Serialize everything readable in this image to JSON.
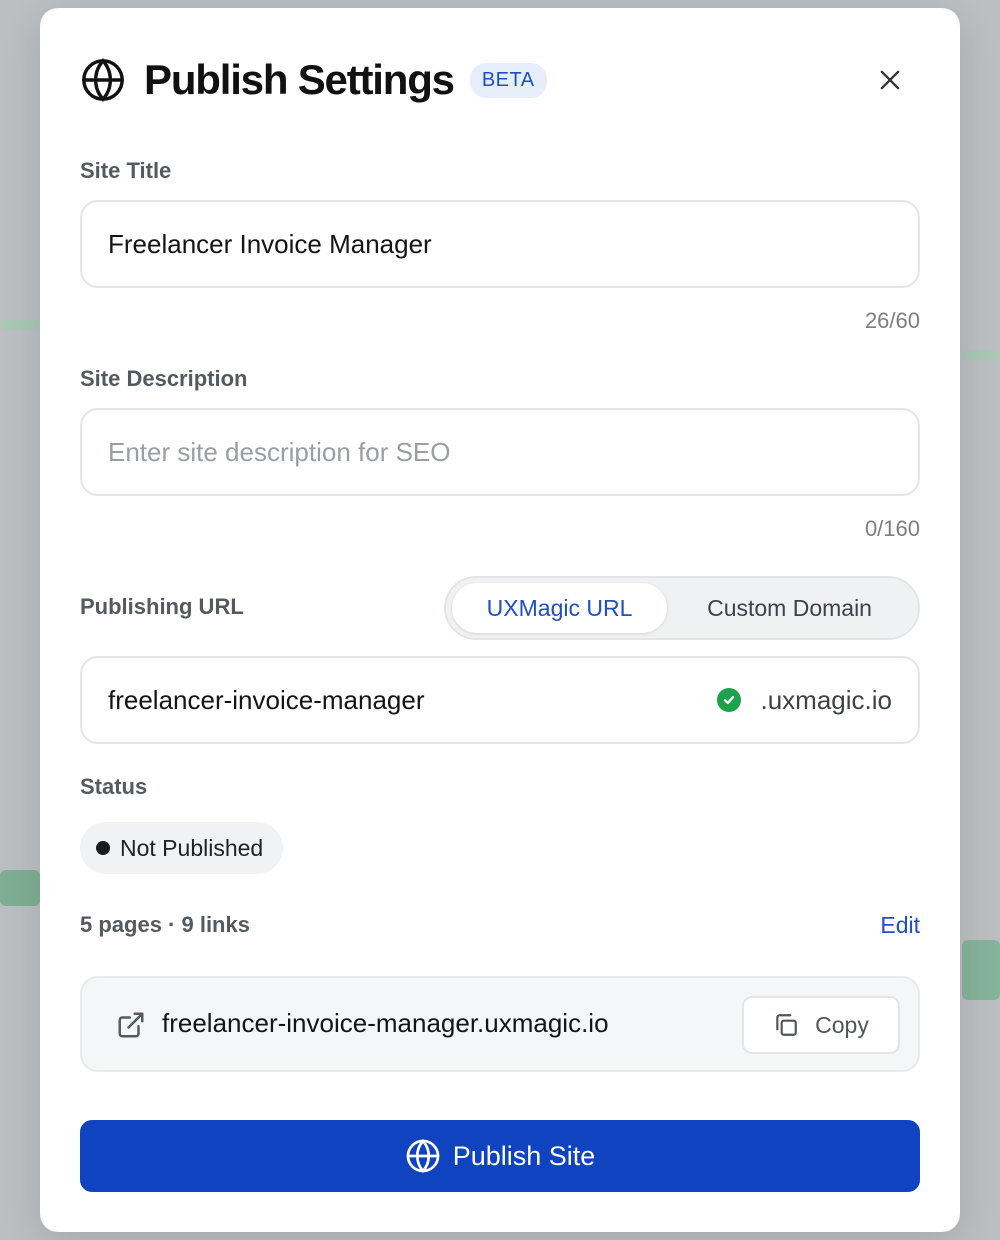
{
  "modal": {
    "title": "Publish Settings",
    "badge": "BETA"
  },
  "site_title": {
    "label": "Site Title",
    "value": "Freelancer Invoice Manager",
    "counter": "26/60"
  },
  "site_description": {
    "label": "Site Description",
    "placeholder": "Enter site description for SEO",
    "counter": "0/160"
  },
  "publishing_url": {
    "label": "Publishing URL",
    "options": [
      "UXMagic URL",
      "Custom Domain"
    ],
    "selected": "UXMagic URL",
    "slug": "freelancer-invoice-manager",
    "domain_suffix": ".uxmagic.io",
    "available": true
  },
  "status": {
    "label": "Status",
    "value": "Not Published"
  },
  "summary": {
    "text": "5 pages · 9 links",
    "edit_label": "Edit"
  },
  "link": {
    "url": "freelancer-invoice-manager.uxmagic.io",
    "copy_label": "Copy"
  },
  "publish_button": {
    "label": "Publish Site"
  },
  "colors": {
    "accent": "#1043c0",
    "link_blue": "#1e4fc6",
    "success": "#1aa34a"
  },
  "icons": [
    "globe-icon",
    "close-icon",
    "check-circle-icon",
    "external-link-icon",
    "copy-icon"
  ]
}
